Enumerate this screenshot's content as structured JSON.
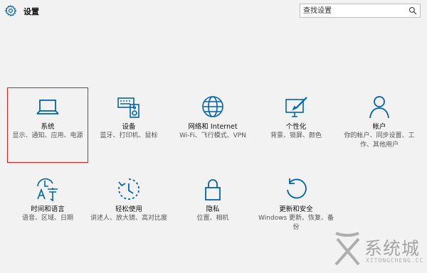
{
  "header": {
    "title": "设置",
    "search_placeholder": "查找设置"
  },
  "accent_color": "#0063b1",
  "selection_color": "#e01a1a",
  "tiles": [
    {
      "id": "system",
      "icon": "laptop-icon",
      "label": "系统",
      "description": "显示、通知、应用、电源",
      "selected": true
    },
    {
      "id": "devices",
      "icon": "devices-icon",
      "label": "设备",
      "description": "蓝牙、打印机、鼠标",
      "selected": false
    },
    {
      "id": "network",
      "icon": "globe-icon",
      "label": "网络和 Internet",
      "description": "Wi-Fi、飞行模式、VPN",
      "selected": false
    },
    {
      "id": "personalization",
      "icon": "personalization-icon",
      "label": "个性化",
      "description": "背景、锁屏、颜色",
      "selected": false
    },
    {
      "id": "accounts",
      "icon": "person-icon",
      "label": "帐户",
      "description": "你的帐户、同步设置、工作、其他用户",
      "selected": false
    },
    {
      "id": "time-language",
      "icon": "time-language-icon",
      "label": "时间和语言",
      "description": "语音、区域、日期",
      "selected": false
    },
    {
      "id": "ease-of-access",
      "icon": "ease-of-access-icon",
      "label": "轻松使用",
      "description": "讲述人、放大镜、高对比度",
      "selected": false
    },
    {
      "id": "privacy",
      "icon": "lock-icon",
      "label": "隐私",
      "description": "位置、相机",
      "selected": false
    },
    {
      "id": "update-security",
      "icon": "refresh-icon",
      "label": "更新和安全",
      "description": "Windows 更新、恢复、备份",
      "selected": false
    }
  ],
  "watermark": {
    "text": "系统城",
    "subtext": "XITONGCHENG.CC"
  }
}
